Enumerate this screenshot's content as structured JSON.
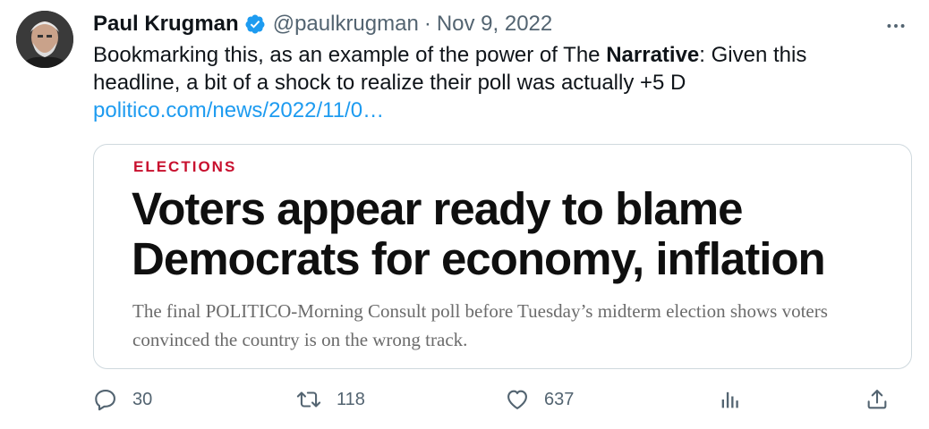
{
  "author": {
    "name": "Paul Krugman",
    "handle": "@paulkrugman",
    "separator": "·",
    "date": "Nov 9, 2022"
  },
  "tweet": {
    "text_before": "Bookmarking this, as an example of the power of The ",
    "text_bold": "Narrative",
    "text_after": ": Given this headline, a bit of a shock to realize their poll was actually +5 D",
    "link": "politico.com/news/2022/11/0…"
  },
  "card": {
    "section": "ELECTIONS",
    "headline": "Voters appear ready to blame Democrats for economy, inflation",
    "subhead": "The final POLITICO-Morning Consult poll before Tuesday’s midterm election shows voters convinced the country is on the wrong track."
  },
  "actions": {
    "replies": "30",
    "retweets": "118",
    "likes": "637",
    "views": ""
  },
  "icons": {
    "verified": "verified-badge-icon",
    "more": "more-icon",
    "reply": "reply-icon",
    "retweet": "retweet-icon",
    "like": "heart-icon",
    "views": "analytics-icon",
    "share": "share-icon"
  },
  "colors": {
    "link": "#1d9bf0",
    "verified": "#1d9bf0",
    "section": "#c8102e",
    "muted": "#536471"
  }
}
